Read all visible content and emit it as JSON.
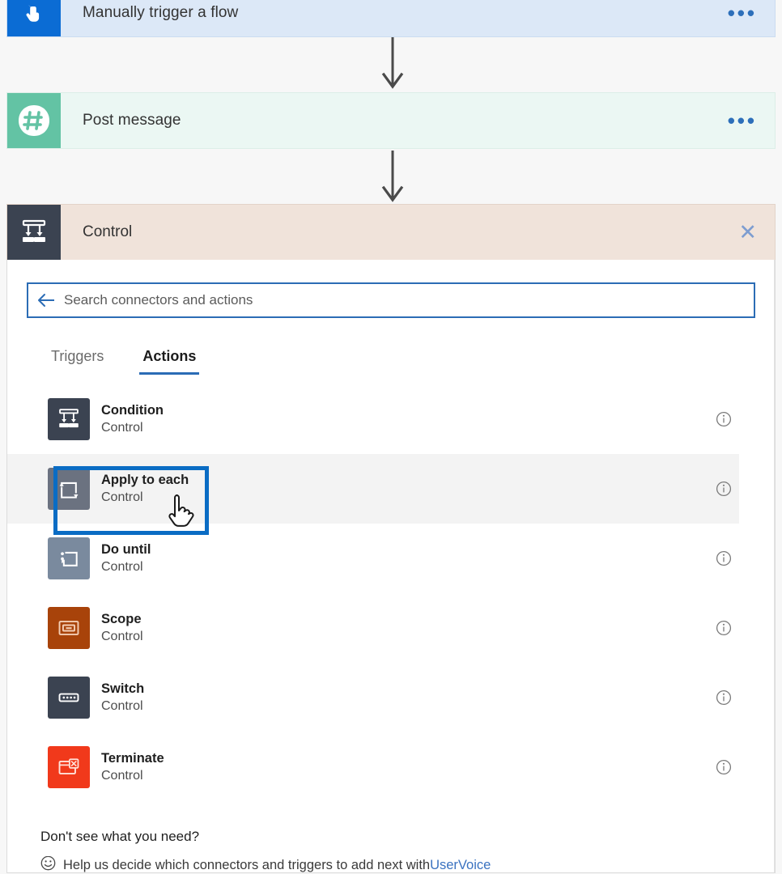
{
  "flow": {
    "trigger_card": {
      "title": "Manually trigger a flow",
      "icon": "hand-tap-icon",
      "menu": "•••",
      "bg": "#dce8f7",
      "icon_bg": "#0b6cd4"
    },
    "post_card": {
      "title": "Post message",
      "icon": "slack-hash-icon",
      "menu": "•••",
      "bg": "#ebf7f3",
      "icon_bg": "#63c3a4"
    }
  },
  "panel": {
    "title": "Control",
    "icon": "control-branch-icon",
    "close_label": "✕",
    "header_bg": "#f0e3da",
    "icon_bg": "#3b4351"
  },
  "search": {
    "placeholder": "Search connectors and actions",
    "value": "",
    "back_icon": "back-arrow-icon",
    "border_color": "#2b6cb5"
  },
  "tabs": [
    {
      "label": "Triggers",
      "active": false
    },
    {
      "label": "Actions",
      "active": true
    }
  ],
  "actions": [
    {
      "name": "Condition",
      "subtitle": "Control",
      "icon": "condition-branch-icon",
      "tile_color": "#3b4351",
      "highlighted": false,
      "focused": false
    },
    {
      "name": "Apply to each",
      "subtitle": "Control",
      "icon": "loop-foreach-icon",
      "tile_color": "#6b7280",
      "highlighted": true,
      "focused": true
    },
    {
      "name": "Do until",
      "subtitle": "Control",
      "icon": "do-until-loop-icon",
      "tile_color": "#7a8a9e",
      "highlighted": false,
      "focused": false
    },
    {
      "name": "Scope",
      "subtitle": "Control",
      "icon": "scope-nested-box-icon",
      "tile_color": "#a8430a",
      "highlighted": false,
      "focused": false
    },
    {
      "name": "Switch",
      "subtitle": "Control",
      "icon": "switch-icon",
      "tile_color": "#3b4351",
      "highlighted": false,
      "focused": false
    },
    {
      "name": "Terminate",
      "subtitle": "Control",
      "icon": "terminate-icon",
      "tile_color": "#f1391b",
      "highlighted": false,
      "focused": false
    }
  ],
  "info_icon_label": "ⓘ",
  "footer": {
    "title": "Don't see what you need?",
    "message_prefix": "Help us decide which connectors and triggers to add next with ",
    "link_text": "UserVoice",
    "smiley_icon": "smiley-face-icon"
  },
  "colors": {
    "accent_blue": "#0a6cc4",
    "tab_underline": "#2b6cb5",
    "link": "#3a72c0",
    "arrow": "#4a4a4a"
  }
}
